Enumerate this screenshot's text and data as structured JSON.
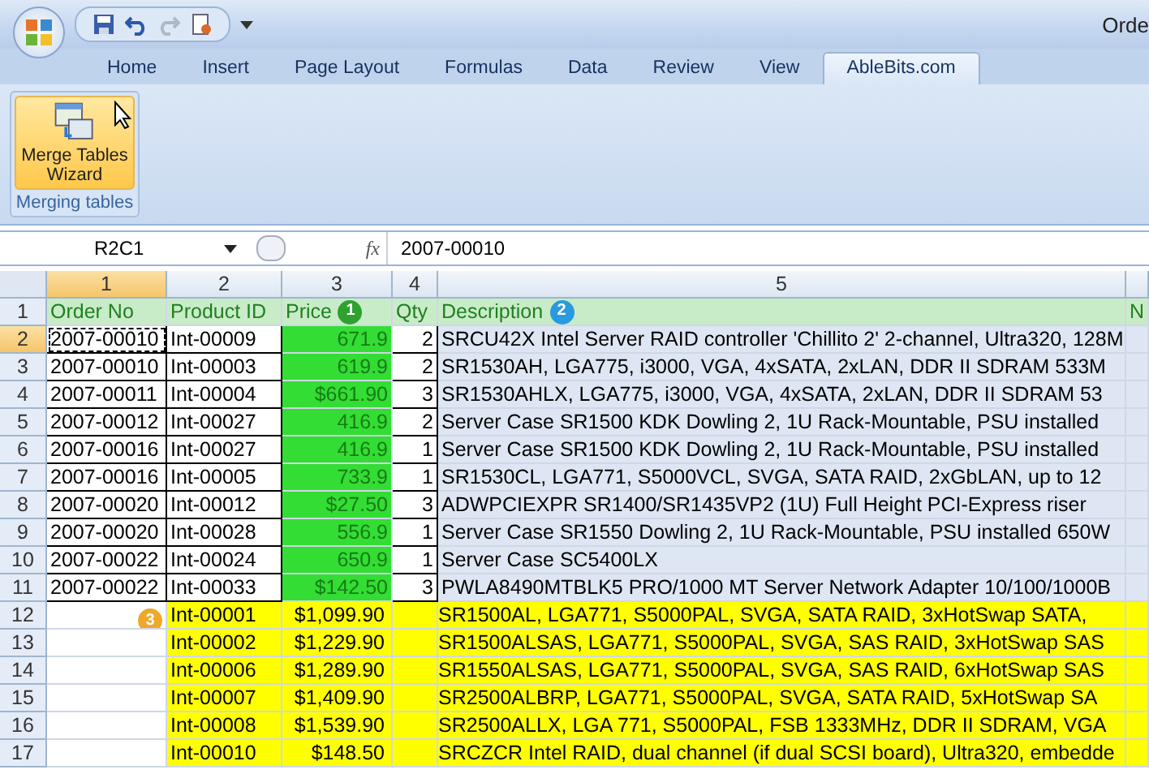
{
  "window": {
    "title": "Orde"
  },
  "ribbon_tabs": [
    {
      "label": "Home",
      "selected": false
    },
    {
      "label": "Insert",
      "selected": false
    },
    {
      "label": "Page Layout",
      "selected": false
    },
    {
      "label": "Formulas",
      "selected": false
    },
    {
      "label": "Data",
      "selected": false
    },
    {
      "label": "Review",
      "selected": false
    },
    {
      "label": "View",
      "selected": false
    },
    {
      "label": "AbleBits.com",
      "selected": true
    }
  ],
  "ribbon": {
    "button": "Merge Tables Wizard",
    "group": "Merging tables"
  },
  "formula_bar": {
    "name_box": "R2C1",
    "fx": "fx",
    "value": "2007-00010"
  },
  "columns": [
    {
      "label": "1",
      "selected": true
    },
    {
      "label": "2",
      "selected": false
    },
    {
      "label": "3",
      "selected": false
    },
    {
      "label": "4",
      "selected": false
    },
    {
      "label": "5",
      "selected": false
    }
  ],
  "header": {
    "row": "1",
    "cells": [
      "Order No",
      "Product ID",
      "Price",
      "Qty",
      "Description",
      "N"
    ]
  },
  "badges": [
    {
      "text": "1",
      "color": "#2ea12e"
    },
    {
      "text": "2",
      "color": "#2a9ae0"
    },
    {
      "text": "3",
      "color": "#f0a82a"
    }
  ],
  "rows": [
    {
      "row": "2",
      "kind": "matched",
      "selected": true,
      "cells": [
        "2007-00010",
        "Int-00009",
        "671.9",
        "2",
        "SRCU42X Intel Server RAID controller 'Chillito 2' 2-channel, Ultra320, 128M"
      ]
    },
    {
      "row": "3",
      "kind": "matched",
      "selected": false,
      "cells": [
        "2007-00010",
        "Int-00003",
        "619.9",
        "2",
        "SR1530AH, LGA775, i3000, VGA, 4xSATA, 2xLAN, DDR II SDRAM 533M"
      ]
    },
    {
      "row": "4",
      "kind": "matched",
      "selected": false,
      "cells": [
        "2007-00011",
        "Int-00004",
        "$661.90",
        "3",
        "SR1530AHLX, LGA775, i3000, VGA, 4xSATA, 2xLAN, DDR II SDRAM 53"
      ]
    },
    {
      "row": "5",
      "kind": "matched",
      "selected": false,
      "cells": [
        "2007-00012",
        "Int-00027",
        "416.9",
        "2",
        "Server Case SR1500 KDK Dowling 2, 1U Rack-Mountable, PSU installed"
      ]
    },
    {
      "row": "6",
      "kind": "matched",
      "selected": false,
      "cells": [
        "2007-00016",
        "Int-00027",
        "416.9",
        "1",
        "Server Case SR1500 KDK Dowling 2, 1U Rack-Mountable, PSU installed"
      ]
    },
    {
      "row": "7",
      "kind": "matched",
      "selected": false,
      "cells": [
        "2007-00016",
        "Int-00005",
        "733.9",
        "1",
        "SR1530CL, LGA771, S5000VCL, SVGA, SATA RAID, 2xGbLAN, up to 12"
      ]
    },
    {
      "row": "8",
      "kind": "matched",
      "selected": false,
      "cells": [
        "2007-00020",
        "Int-00012",
        "$27.50",
        "3",
        "ADWPCIEXPR SR1400/SR1435VP2 (1U) Full Height PCI-Express riser"
      ]
    },
    {
      "row": "9",
      "kind": "matched",
      "selected": false,
      "cells": [
        "2007-00020",
        "Int-00028",
        "556.9",
        "1",
        "Server Case SR1550 Dowling 2, 1U Rack-Mountable, PSU installed 650W"
      ]
    },
    {
      "row": "10",
      "kind": "matched",
      "selected": false,
      "cells": [
        "2007-00022",
        "Int-00024",
        "650.9",
        "1",
        "Server Case SC5400LX"
      ]
    },
    {
      "row": "11",
      "kind": "matched",
      "selected": false,
      "cells": [
        "2007-00022",
        "Int-00033",
        "$142.50",
        "3",
        "PWLA8490MTBLK5 PRO/1000 MT Server Network Adapter 10/100/1000B"
      ]
    },
    {
      "row": "12",
      "kind": "added",
      "selected": false,
      "cells": [
        "",
        "Int-00001",
        "$1,099.90",
        "",
        "SR1500AL, LGA771, S5000PAL, SVGA, SATA RAID, 3xHotSwap SATA,"
      ]
    },
    {
      "row": "13",
      "kind": "added",
      "selected": false,
      "cells": [
        "",
        "Int-00002",
        "$1,229.90",
        "",
        "SR1500ALSAS, LGA771, S5000PAL, SVGA, SAS RAID, 3xHotSwap SAS"
      ]
    },
    {
      "row": "14",
      "kind": "added",
      "selected": false,
      "cells": [
        "",
        "Int-00006",
        "$1,289.90",
        "",
        "SR1550ALSAS, LGA771, S5000PAL, SVGA, SAS RAID, 6xHotSwap SAS"
      ]
    },
    {
      "row": "15",
      "kind": "added",
      "selected": false,
      "cells": [
        "",
        "Int-00007",
        "$1,409.90",
        "",
        "SR2500ALBRP, LGA771, S5000PAL, SVGA, SATA RAID, 5xHotSwap SA"
      ]
    },
    {
      "row": "16",
      "kind": "added",
      "selected": false,
      "cells": [
        "",
        "Int-00008",
        "$1,539.90",
        "",
        "SR2500ALLX, LGA 771, S5000PAL, FSB 1333MHz, DDR II SDRAM, VGA"
      ]
    },
    {
      "row": "17",
      "kind": "added",
      "selected": false,
      "cells": [
        "",
        "Int-00010",
        "$148.50",
        "",
        "SRCZCR Intel RAID, dual channel (if dual SCSI board), Ultra320, embedde"
      ]
    }
  ]
}
